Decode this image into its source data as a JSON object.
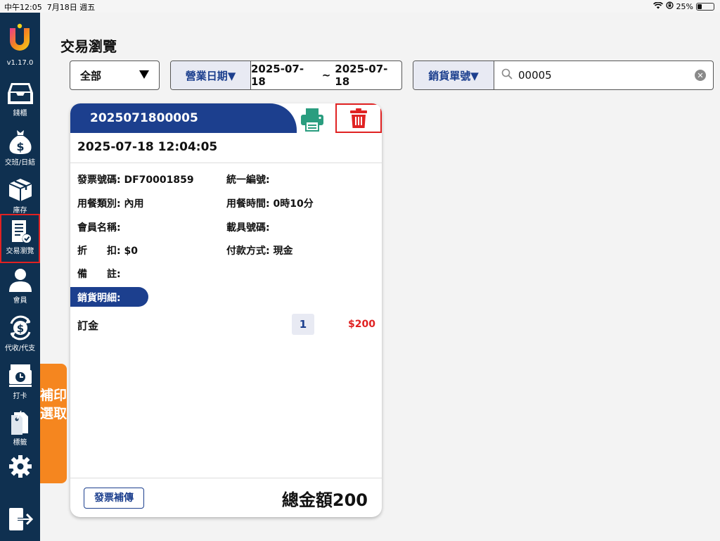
{
  "status_bar": {
    "time": "中午12:05",
    "date": "7月18日 週五",
    "battery": "25%"
  },
  "sidebar": {
    "version": "v1.17.0",
    "items": [
      {
        "label": "錢櫃",
        "icon": "cash-drawer-icon"
      },
      {
        "label": "交班/日結",
        "icon": "money-bag-icon"
      },
      {
        "label": "庫存",
        "icon": "box-icon"
      },
      {
        "label": "交易瀏覽",
        "icon": "receipt-check-icon"
      },
      {
        "label": "會員",
        "icon": "member-icon"
      },
      {
        "label": "代收/代支",
        "icon": "dollar-cycle-icon"
      },
      {
        "label": "打卡",
        "icon": "time-clock-icon"
      },
      {
        "label": "標籤",
        "icon": "tag-icon"
      }
    ],
    "active_index": 3
  },
  "reprint_tab": {
    "label": "補印選取"
  },
  "page_title": "交易瀏覽",
  "filters": {
    "type_select": "全部",
    "date_tag": "營業日期▼",
    "date_start": "2025-07-18",
    "date_sep": "~",
    "date_end": "2025-07-18",
    "search_tag": "銷貨單號▼",
    "search_value": "00005"
  },
  "card": {
    "order_no": "2025071800005",
    "datetime": "2025-07-18  12:04:05",
    "fields": [
      {
        "label": "發票號碼:",
        "value": "DF70001859"
      },
      {
        "label": "統一編號:",
        "value": ""
      },
      {
        "label": "用餐類別:",
        "value": "內用"
      },
      {
        "label": "用餐時間:",
        "value": "0時10分"
      },
      {
        "label": "會員名稱:",
        "value": ""
      },
      {
        "label": "載具號碼:",
        "value": ""
      },
      {
        "label": "折　　扣:",
        "value": "$0"
      },
      {
        "label": "付款方式:",
        "value": "現金"
      },
      {
        "label": "備　　註:",
        "value": ""
      }
    ],
    "section_label": "銷貨明細:",
    "item": {
      "name": "訂金",
      "qty": "1",
      "price": "$200"
    },
    "reupload_label": "發票補傳",
    "total": "總金額200"
  },
  "colors": {
    "sidebar": "#0f3050",
    "brand_blue": "#1c3f8e",
    "accent_orange": "#f5861f",
    "danger_red": "#e02222",
    "printer_green": "#2a9d7f"
  }
}
